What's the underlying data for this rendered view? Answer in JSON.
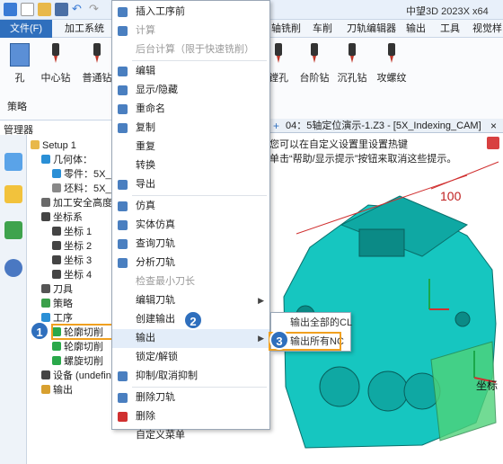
{
  "window": {
    "title": "中望3D 2023X x64"
  },
  "menubar": {
    "file": "文件(F)",
    "tabs": [
      "加工系统",
      "轴铣削",
      "车削",
      "刀轨编辑器",
      "输出",
      "工具",
      "视觉样"
    ]
  },
  "ribbon": {
    "left_buttons": [
      {
        "label": "孔",
        "icon": "hole-icon"
      },
      {
        "label": "中心钻",
        "icon": "center-drill-icon"
      },
      {
        "label": "普通钻",
        "icon": "drill-icon"
      }
    ],
    "right_buttons": [
      {
        "label": "镗孔",
        "icon": "bore-icon"
      },
      {
        "label": "台阶钻",
        "icon": "step-drill-icon"
      },
      {
        "label": "沉孔钻",
        "icon": "counterbore-drill-icon"
      },
      {
        "label": "攻螺纹",
        "icon": "tap-icon"
      }
    ],
    "group_label": "策略"
  },
  "manager": {
    "label": "管理器"
  },
  "tree": {
    "items": [
      {
        "label": "Setup 1",
        "indent": 0,
        "icon": "folder-icon"
      },
      {
        "label": "几何体：",
        "indent": 1,
        "icon": "geometry-icon"
      },
      {
        "label": "零件：5X_In",
        "indent": 2,
        "icon": "part-icon"
      },
      {
        "label": "坯料：5X_In",
        "indent": 2,
        "icon": "stock-icon"
      },
      {
        "label": "加工安全高度",
        "indent": 1,
        "icon": "safety-icon"
      },
      {
        "label": "坐标系",
        "indent": 1,
        "icon": "csys-icon"
      },
      {
        "label": "坐标 1",
        "indent": 2,
        "icon": "csys-icon"
      },
      {
        "label": "坐标 2",
        "indent": 2,
        "icon": "csys-icon"
      },
      {
        "label": "坐标 3",
        "indent": 2,
        "icon": "csys-icon"
      },
      {
        "label": "坐标 4",
        "indent": 2,
        "icon": "csys-icon"
      },
      {
        "label": "刀具",
        "indent": 1,
        "icon": "tool-icon"
      },
      {
        "label": "策略",
        "indent": 1,
        "icon": "strategy-icon"
      },
      {
        "label": "工序",
        "indent": 1,
        "icon": "operation-icon"
      },
      {
        "label": "轮廓切削",
        "indent": 2,
        "icon": "check-icon"
      },
      {
        "label": "轮廓切削",
        "indent": 2,
        "icon": "check-icon"
      },
      {
        "label": "螺旋切削",
        "indent": 2,
        "icon": "check-icon"
      },
      {
        "label": "设备 (undefin",
        "indent": 1,
        "icon": "machine-icon"
      },
      {
        "label": "输出",
        "indent": 1,
        "icon": "output-icon"
      }
    ]
  },
  "context_menu": {
    "items": [
      {
        "label": "插入工序前",
        "disabled": false,
        "icon": "insert-icon"
      },
      {
        "label": "计算",
        "disabled": true,
        "icon": "calc-icon"
      },
      {
        "label": "后台计算（限于快速铣削）",
        "disabled": true,
        "icon": ""
      },
      {
        "label": "编辑",
        "disabled": false,
        "icon": "edit-icon"
      },
      {
        "label": "显示/隐藏",
        "disabled": false,
        "icon": "visibility-icon"
      },
      {
        "label": "重命名",
        "disabled": false,
        "icon": "rename-icon"
      },
      {
        "label": "复制",
        "disabled": false,
        "icon": "copy-icon"
      },
      {
        "label": "重复",
        "disabled": false,
        "icon": ""
      },
      {
        "label": "转换",
        "disabled": false,
        "icon": ""
      },
      {
        "label": "导出",
        "disabled": false,
        "icon": "export-icon"
      },
      {
        "label": "仿真",
        "disabled": false,
        "icon": "simulate-icon"
      },
      {
        "label": "实体仿真",
        "disabled": false,
        "icon": "solid-sim-icon"
      },
      {
        "label": "查询刀轨",
        "disabled": false,
        "icon": "query-icon"
      },
      {
        "label": "分析刀轨",
        "disabled": false,
        "icon": "analyze-icon"
      },
      {
        "label": "检查最小刀长",
        "disabled": true,
        "icon": ""
      },
      {
        "label": "编辑刀轨",
        "disabled": false,
        "icon": ""
      },
      {
        "label": "创建输出",
        "disabled": false,
        "icon": ""
      },
      {
        "label": "输出",
        "disabled": false,
        "icon": ""
      },
      {
        "label": "锁定/解锁",
        "disabled": false,
        "icon": ""
      },
      {
        "label": "抑制/取消抑制",
        "disabled": false,
        "icon": "suppress-icon"
      },
      {
        "label": "删除刀轨",
        "disabled": false,
        "icon": "delete-path-icon"
      },
      {
        "label": "删除",
        "disabled": false,
        "icon": "delete-icon"
      },
      {
        "label": "自定义菜单",
        "disabled": false,
        "icon": ""
      }
    ]
  },
  "submenu": {
    "items": [
      "输出全部的CL",
      "输出所有NC"
    ]
  },
  "document": {
    "tab": "04：5轴定位演示-1.Z3 - [5X_Indexing_CAM]",
    "hint1": "您可以在自定义设置里设置热键",
    "hint2": "单击“帮助/显示提示”按钮来取消这些提示。"
  },
  "viewport": {
    "dimension": "100",
    "axis_label": "坐标"
  },
  "callouts": [
    "1",
    "2",
    "3"
  ],
  "colors": {
    "accent": "#2f6fbd",
    "highlight": "#f0a020",
    "model": "#16c6c0"
  }
}
